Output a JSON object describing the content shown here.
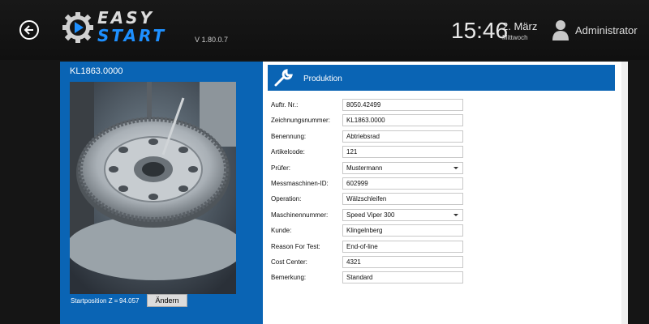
{
  "header": {
    "logo_line1": "EASY",
    "logo_line2": "START",
    "version": "V 1.80.0.7",
    "time": "15:46",
    "date_day": "2. März",
    "date_weekday": "Mittwoch",
    "user_name": "Administrator"
  },
  "left": {
    "part_number": "KL1863.0000",
    "startpos_label": "Startposition Z =",
    "startpos_value": "94.057",
    "change_label": "Ändern"
  },
  "form": {
    "title": "Produktion",
    "fields": [
      {
        "label": "Auftr. Nr.:",
        "value": "8050.42499",
        "type": "text"
      },
      {
        "label": "Zeichnungsnummer:",
        "value": "KL1863.0000",
        "type": "text"
      },
      {
        "label": "Benennung:",
        "value": "Abtriebsrad",
        "type": "text"
      },
      {
        "label": "Artikelcode:",
        "value": "121",
        "type": "text"
      },
      {
        "label": "Prüfer:",
        "value": "Mustermann",
        "type": "select"
      },
      {
        "label": "Messmaschinen-ID:",
        "value": "602999",
        "type": "text"
      },
      {
        "label": "Operation:",
        "value": "Wälzschleifen",
        "type": "text"
      },
      {
        "label": "Maschinennummer:",
        "value": "Speed Viper 300",
        "type": "select"
      },
      {
        "label": "Kunde:",
        "value": "Klingelnberg",
        "type": "text"
      },
      {
        "label": "Reason For Test:",
        "value": "End-of-line",
        "type": "text"
      },
      {
        "label": "Cost Center:",
        "value": "4321",
        "type": "text"
      },
      {
        "label": "Bemerkung:",
        "value": "Standard",
        "type": "text"
      }
    ]
  },
  "colors": {
    "accent_blue": "#0a64b4",
    "logo_blue": "#1e90ff",
    "background": "#151515"
  },
  "icons": [
    "back-arrow-icon",
    "gear-logo-icon",
    "play-icon",
    "user-icon",
    "wrench-icon",
    "chevron-down-icon"
  ]
}
